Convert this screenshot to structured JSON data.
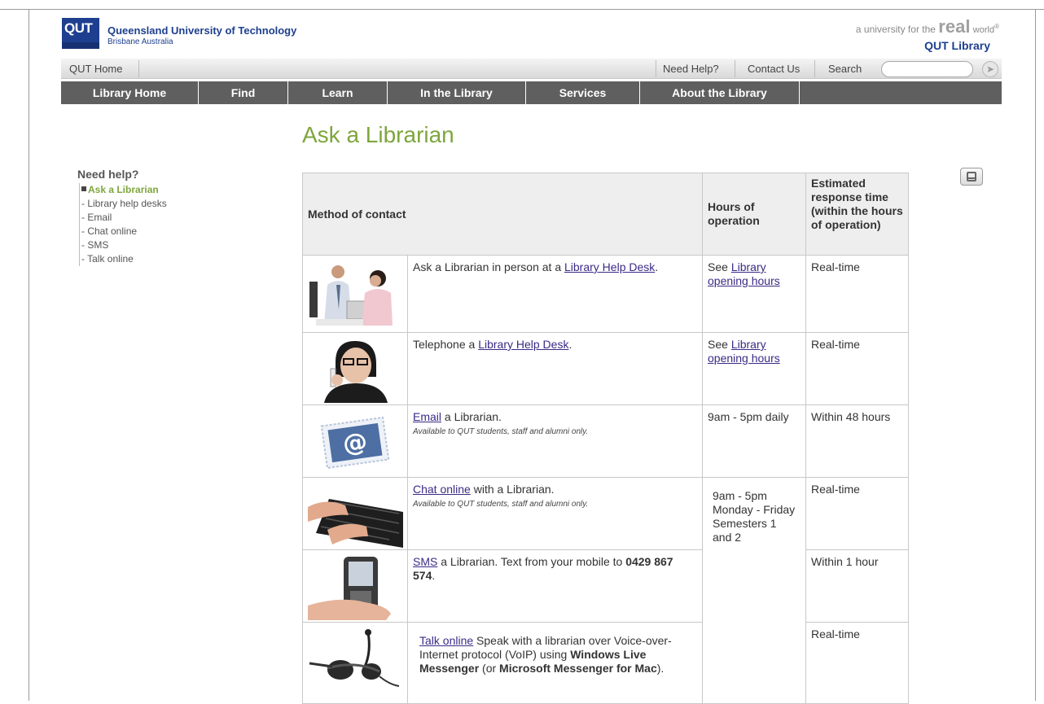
{
  "header": {
    "logo_text": "QUT",
    "university_name": "Queensland University of Technology",
    "location": "Brisbane Australia",
    "tagline_pre": "a university for the",
    "tagline_real": "real",
    "tagline_world": "world",
    "tagline_mark": "®",
    "site_name": "QUT Library"
  },
  "utility_bar": {
    "home": "QUT Home",
    "need_help": "Need Help?",
    "contact": "Contact Us",
    "search_label": "Search",
    "search_value": ""
  },
  "main_nav": [
    {
      "label": "Library Home"
    },
    {
      "label": "Find"
    },
    {
      "label": "Learn"
    },
    {
      "label": "In the Library"
    },
    {
      "label": "Services"
    },
    {
      "label": "About the Library"
    }
  ],
  "page_title": "Ask a Librarian",
  "sidebar": {
    "heading": "Need help?",
    "items": [
      {
        "label": "Ask a Librarian",
        "active": true
      },
      {
        "label": "- Library help desks"
      },
      {
        "label": "- Email"
      },
      {
        "label": "- Chat online"
      },
      {
        "label": "- SMS"
      },
      {
        "label": "- Talk online"
      }
    ]
  },
  "table": {
    "headers": {
      "method": "Method of contact",
      "hours": "Hours of operation",
      "response": "Estimated response time (within the hours of operation)"
    },
    "rows": [
      {
        "pre": "Ask a Librarian in person at a ",
        "link": "Library Help Desk",
        "post": ".",
        "hours_pre": "See ",
        "hours_link": "Library opening hours",
        "response": "Real-time"
      },
      {
        "pre": "Telephone a ",
        "link": "Library Help Desk",
        "post": ".",
        "hours_pre": "See ",
        "hours_link": "Library opening hours",
        "response": "Real-time"
      },
      {
        "link": "Email",
        "post": " a Librarian.",
        "note": "Available to QUT students, staff and alumni only.",
        "hours": "9am - 5pm daily",
        "response": "Within 48 hours"
      },
      {
        "link": "Chat online",
        "post": " with a Librarian.",
        "note": "Available to QUT students, staff and alumni only.",
        "response": "Real-time"
      },
      {
        "link": "SMS",
        "post": " a Librarian. Text from your mobile to ",
        "bold": "0429 867 574",
        "post2": ".",
        "response": "Within 1 hour"
      },
      {
        "link": "Talk online",
        "post": " Speak with a librarian over Voice-over-Internet protocol (VoIP) using ",
        "bold1": "Windows Live Messenger",
        "mid": " (or ",
        "bold2": "Microsoft Messenger for Mac",
        "end": ").",
        "response": "Real-time"
      }
    ],
    "merged_hours": "9am - 5pm Monday - Friday Semesters 1 and 2"
  },
  "colors": {
    "brand_blue": "#1e3f8f",
    "accent_green": "#7ea63c",
    "nav_gray": "#5f5f5f",
    "link_purple": "#3b2a86"
  }
}
